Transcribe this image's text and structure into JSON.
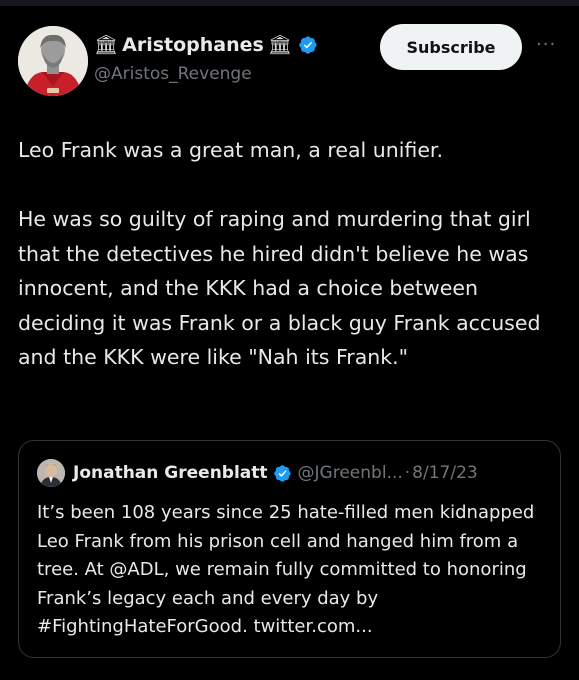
{
  "tweet": {
    "display_name": "Aristophanes",
    "name_emoji_left": "🏛",
    "name_emoji_right": "🏛",
    "handle": "@Aristos_Revenge",
    "subscribe_label": "Subscribe",
    "more_label": "···",
    "text": "Leo Frank was a great man, a real unifier.\n\nHe was so guilty of raping and murdering that girl that the detectives he hired didn't believe he was innocent, and the KKK had a choice between deciding it was Frank or a black guy Frank accused and the KKK were like \"Nah its Frank.\""
  },
  "quoted_tweet": {
    "display_name": "Jonathan Greenblatt",
    "handle": "@JGreenbl...",
    "separator": "·",
    "date": "8/17/23",
    "text": "It’s been 108 years since 25 hate-filled men kidnapped Leo Frank from his prison cell and hanged him from a tree. At @ADL, we remain fully committed to honoring Frank’s legacy each and every day by #FightingHateForGood. twitter.com..."
  },
  "colors": {
    "background": "#000000",
    "text": "#e7e9ea",
    "secondary_text": "#71767b",
    "verified_blue": "#1d9bf0",
    "subscribe_bg": "#eff3f4",
    "border": "#2f3336"
  },
  "icons": [
    "classical-building-emoji",
    "verified-badge-icon",
    "more-options-icon",
    "avatar-statue-image",
    "avatar-portrait-image"
  ]
}
